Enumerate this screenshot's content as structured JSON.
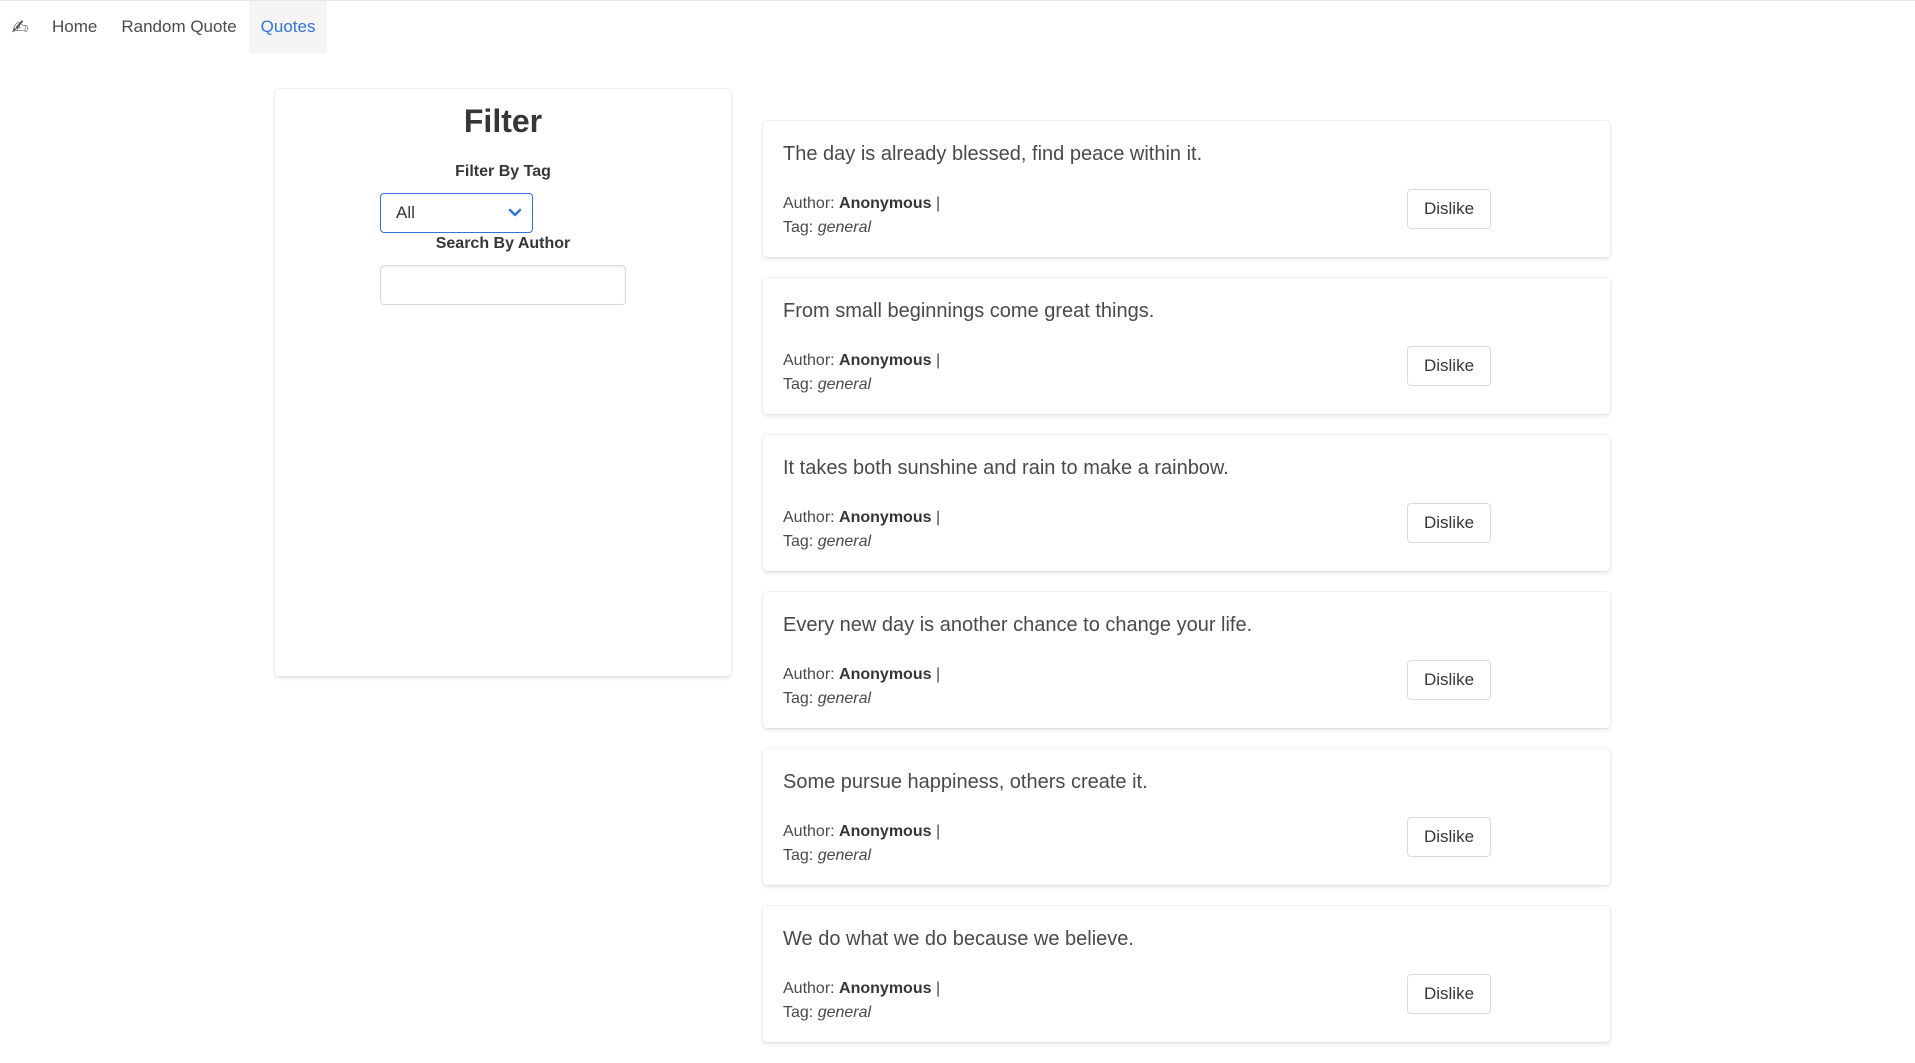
{
  "nav": {
    "brand_glyph": "✍",
    "items": [
      {
        "label": "Home",
        "active": false
      },
      {
        "label": "Random Quote",
        "active": false
      },
      {
        "label": "Quotes",
        "active": true
      }
    ]
  },
  "filter": {
    "title": "Filter",
    "tag_label": "Filter By Tag",
    "tag_selected": "All",
    "author_label": "Search By Author",
    "author_value": ""
  },
  "labels": {
    "author_prefix": "Author:",
    "tag_prefix": "Tag:",
    "separator": "|",
    "dislike": "Dislike"
  },
  "quotes": [
    {
      "text": "The day is already blessed, find peace within it.",
      "author": "Anonymous",
      "tag": "general"
    },
    {
      "text": "From small beginnings come great things.",
      "author": "Anonymous",
      "tag": "general"
    },
    {
      "text": "It takes both sunshine and rain to make a rainbow.",
      "author": "Anonymous",
      "tag": "general"
    },
    {
      "text": "Every new day is another chance to change your life.",
      "author": "Anonymous",
      "tag": "general"
    },
    {
      "text": "Some pursue happiness, others create it.",
      "author": "Anonymous",
      "tag": "general"
    },
    {
      "text": "We do what we do because we believe.",
      "author": "Anonymous",
      "tag": "general"
    }
  ],
  "colors": {
    "accent": "#3273dc",
    "text": "#4a4a4a",
    "heading": "#363636"
  }
}
